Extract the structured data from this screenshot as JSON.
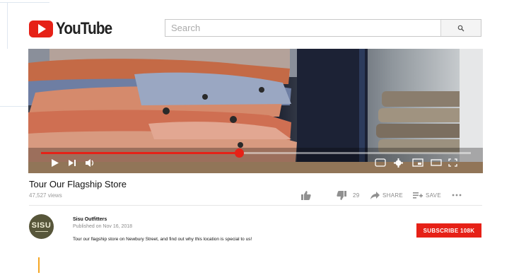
{
  "logo": {
    "text": "YouTube"
  },
  "search": {
    "placeholder": "Search"
  },
  "video": {
    "progress_fraction": 0.46,
    "controls": [
      "play-icon",
      "next-icon",
      "volume-icon",
      "captions-icon",
      "settings-icon",
      "miniplayer-icon",
      "theater-icon",
      "fullscreen-icon"
    ]
  },
  "title": "Tour Our Flagship Store",
  "views": "47,527 views",
  "actions": {
    "dislike_count": "29",
    "share_label": "SHARE",
    "save_label": "SAVE"
  },
  "channel": {
    "avatar_text": "SISU",
    "name": "Sisu Outfitters",
    "published": "Published on Nov 16, 2018",
    "description": "Tour our flagship store on Newbury Street, and find out why this location is special to us!"
  },
  "subscribe": {
    "label": "SUBSCRIBE 108K"
  },
  "colors": {
    "brand_red": "#e62117",
    "accent": "#f5a623"
  }
}
